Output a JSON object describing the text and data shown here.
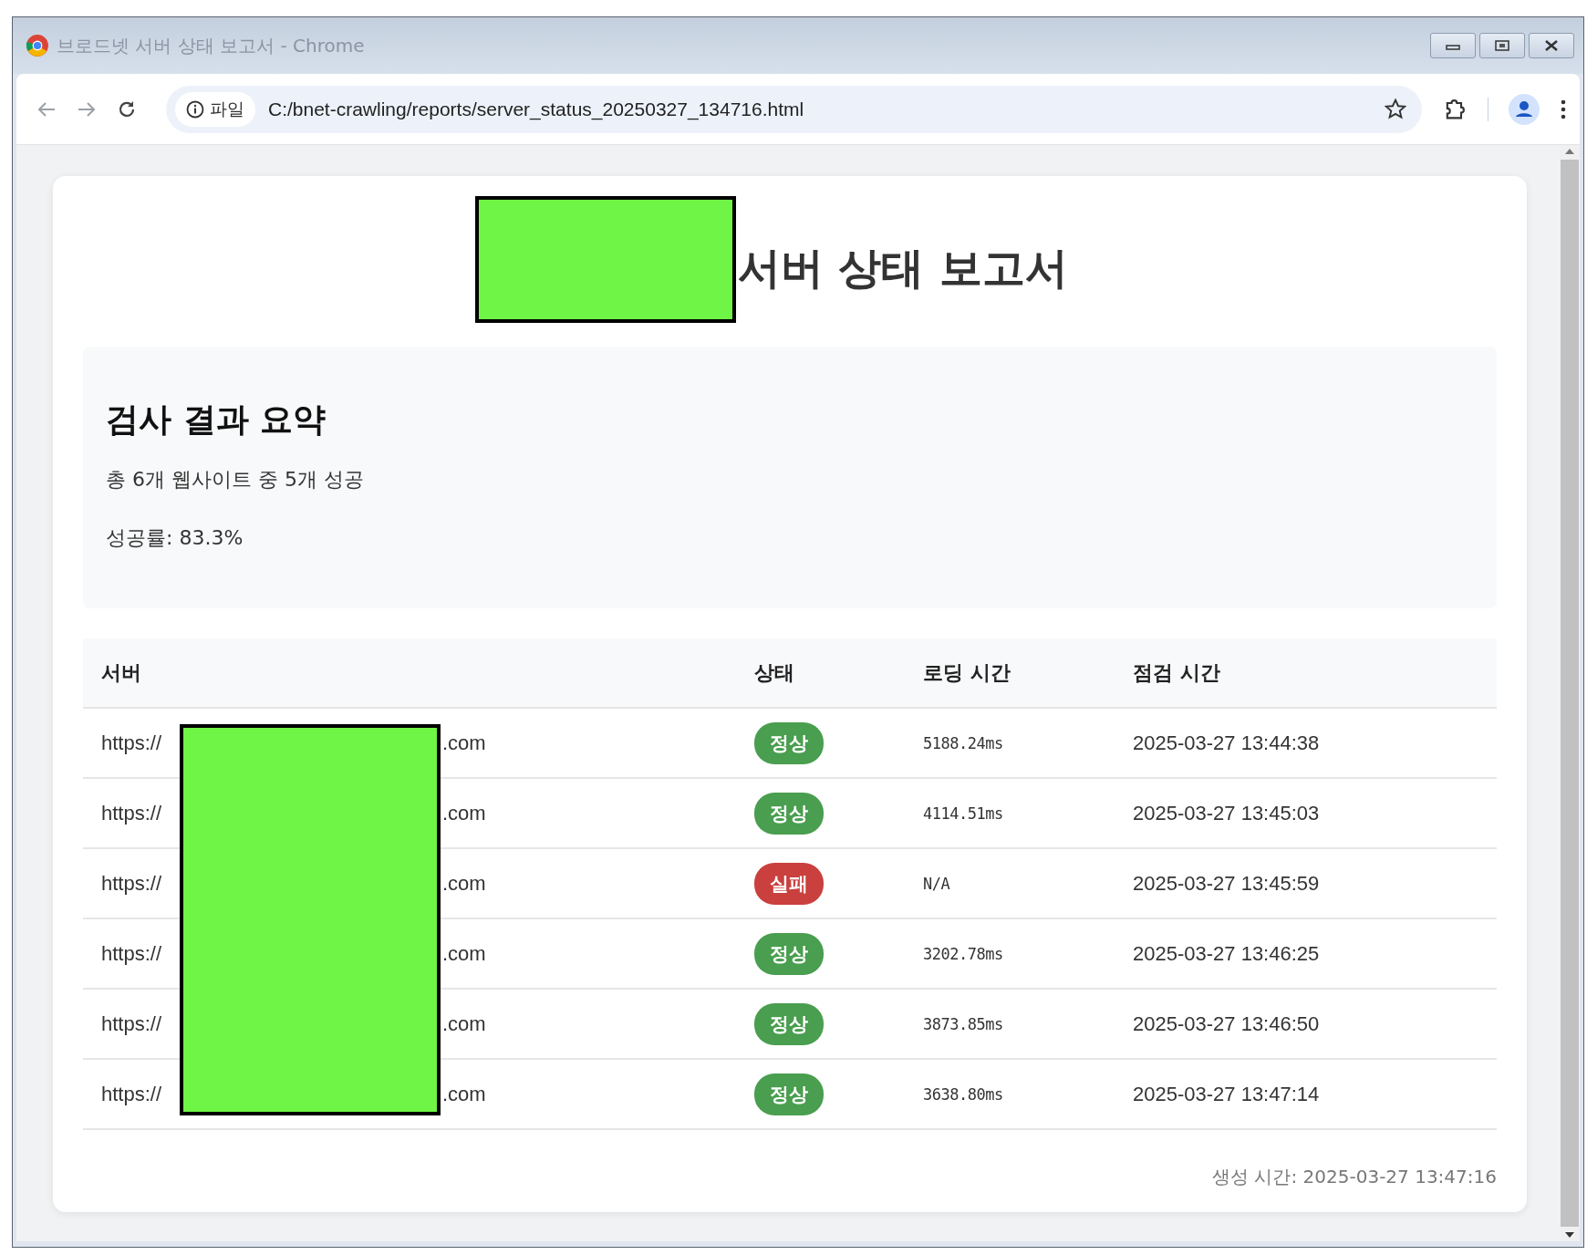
{
  "window": {
    "title": "브로드넷 서버 상태 보고서 - Chrome"
  },
  "address_bar": {
    "chip": "파일",
    "url": "C:/bnet-crawling/reports/server_status_20250327_134716.html"
  },
  "report": {
    "title": "서버 상태 보고서",
    "summary": {
      "heading": "검사 결과 요약",
      "lines": [
        "총 6개 웹사이트 중 5개 성공",
        "성공률: 83.3%"
      ]
    },
    "table": {
      "columns": [
        "서버",
        "상태",
        "로딩 시간",
        "점검 시간"
      ],
      "rows": [
        {
          "server_start": "https://",
          "server_end": ".com",
          "status": "정상",
          "kind": "success",
          "load_time": "5188.24ms",
          "checked_at": "2025-03-27 13:44:38"
        },
        {
          "server_start": "https://",
          "server_end": ".com",
          "status": "정상",
          "kind": "success",
          "load_time": "4114.51ms",
          "checked_at": "2025-03-27 13:45:03"
        },
        {
          "server_start": "https://",
          "server_end": ".com",
          "status": "실패",
          "kind": "failure",
          "load_time": "N/A",
          "checked_at": "2025-03-27 13:45:59"
        },
        {
          "server_start": "https://",
          "server_end": ".com",
          "status": "정상",
          "kind": "success",
          "load_time": "3202.78ms",
          "checked_at": "2025-03-27 13:46:25"
        },
        {
          "server_start": "https://",
          "server_end": ".com",
          "status": "정상",
          "kind": "success",
          "load_time": "3873.85ms",
          "checked_at": "2025-03-27 13:46:50"
        },
        {
          "server_start": "https://",
          "server_end": ".com",
          "status": "정상",
          "kind": "success",
          "load_time": "3638.80ms",
          "checked_at": "2025-03-27 13:47:14"
        }
      ]
    },
    "generated": "생성 시간: 2025-03-27 13:47:16"
  }
}
